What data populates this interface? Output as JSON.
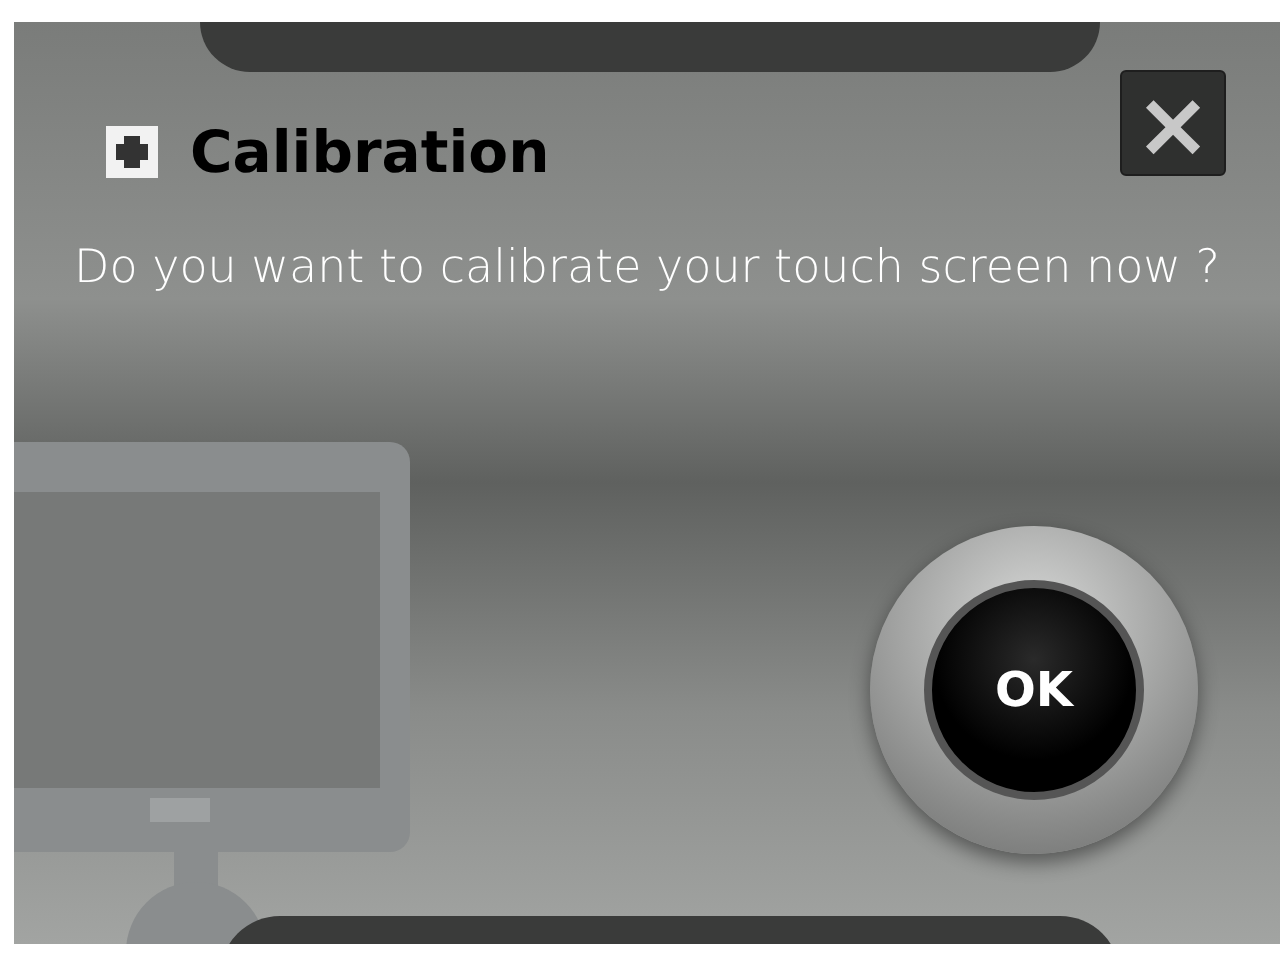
{
  "dialog": {
    "title": "Calibration",
    "message": "Do you want to calibrate your touch screen now ?",
    "close_label": "×",
    "ok_label": "OK"
  }
}
